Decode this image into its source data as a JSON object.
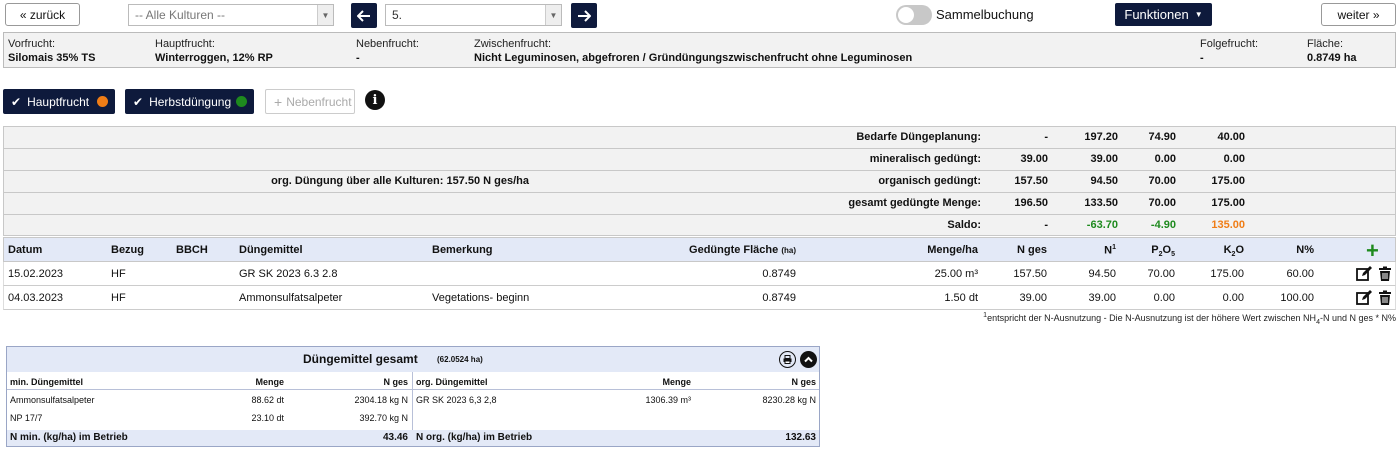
{
  "nav": {
    "back_label": "« zurück",
    "next_label": "weiter »",
    "culture_select": "-- Alle Kulturen --",
    "field_select": "5.",
    "prev_arrow": "🡐",
    "next_arrow": "🡒",
    "sammel_label": "Sammelbuchung",
    "sammel_on": false,
    "functions_label": "Funktionen"
  },
  "info": {
    "vorfrucht_label": "Vorfrucht:",
    "vorfrucht_value": "Silomais 35% TS",
    "hauptfrucht_label": "Hauptfrucht:",
    "hauptfrucht_value": "Winterroggen, 12% RP",
    "nebenfrucht_label": "Nebenfrucht:",
    "nebenfrucht_value": "-",
    "zwischenfrucht_label": "Zwischenfrucht:",
    "zwischenfrucht_value": "Nicht Leguminosen, abgefroren / Gründüngungszwischenfrucht ohne Leguminosen",
    "folgefrucht_label": "Folgefrucht:",
    "folgefrucht_value": "-",
    "flaeche_label": "Fläche:",
    "flaeche_value": "0.8749 ha"
  },
  "pills": {
    "hauptfrucht": "Hauptfrucht",
    "hauptfrucht_color": "#f07d16",
    "herbst": "Herbstdüngung",
    "herbst_color": "#1e8a1e",
    "neben": "Nebenfrucht"
  },
  "summary": {
    "org_note": "org. Düngung über alle Kulturen: 157.50 N ges/ha",
    "rows": [
      {
        "label": "Bedarfe Düngeplanung:",
        "v1": "-",
        "v2": "197.20",
        "v3": "74.90",
        "v4": "40.00"
      },
      {
        "label": "mineralisch gedüngt:",
        "v1": "39.00",
        "v2": "39.00",
        "v3": "0.00",
        "v4": "0.00"
      },
      {
        "label": "organisch gedüngt:",
        "v1": "157.50",
        "v2": "94.50",
        "v3": "70.00",
        "v4": "175.00"
      },
      {
        "label": "gesamt gedüngte Menge:",
        "v1": "196.50",
        "v2": "133.50",
        "v3": "70.00",
        "v4": "175.00"
      },
      {
        "label": "Saldo:",
        "v1": "-",
        "v2": "-63.70",
        "v3": "-4.90",
        "v4": "135.00"
      }
    ],
    "saldo_colors": {
      "negative": "#1e8a1e",
      "positive": "#f07d16"
    }
  },
  "table": {
    "headers": {
      "datum": "Datum",
      "bezug": "Bezug",
      "bbch": "BBCH",
      "duengemittel": "Düngemittel",
      "bemerkung": "Bemerkung",
      "flaeche": "Gedüngte Fläche",
      "flaeche_unit": "(ha)",
      "menge": "Menge/ha",
      "nges": "N ges",
      "n": "N",
      "n_sup": "1",
      "p": "P",
      "p_sub": "2",
      "p_o": "O",
      "p_sub2": "5",
      "k": "K",
      "k_sub": "2",
      "k_o": "O",
      "npct": "N%"
    },
    "rows": [
      {
        "datum": "15.02.2023",
        "bezug": "HF",
        "bbch": "",
        "duengemittel": "GR SK 2023 6.3 2.8",
        "bemerkung": "",
        "flaeche": "0.8749",
        "menge": "25.00 m³",
        "nges": "157.50",
        "n": "94.50",
        "p": "70.00",
        "k": "175.00",
        "npct": "60.00"
      },
      {
        "datum": "04.03.2023",
        "bezug": "HF",
        "bbch": "",
        "duengemittel": "Ammonsulfatsalpeter",
        "bemerkung": "Vegetations- beginn",
        "flaeche": "0.8749",
        "menge": "1.50 dt",
        "nges": "39.00",
        "n": "39.00",
        "p": "0.00",
        "k": "0.00",
        "npct": "100.00"
      }
    ],
    "footnote_sup": "1",
    "footnote_a": "entspricht der N-Ausnutzung - Die N-Ausnutzung ist der höhere Wert zwischen NH",
    "footnote_sub": "4",
    "footnote_b": "-N und N ges * N%"
  },
  "fert": {
    "title": "Düngemittel gesamt",
    "area": "(62.0524 ha)",
    "min_h1": "min. Düngemittel",
    "min_h2": "Menge",
    "min_h3": "N ges",
    "org_h1": "org. Düngemittel",
    "org_h2": "Menge",
    "org_h3": "N ges",
    "min_rows": [
      {
        "name": "Ammonsulfatsalpeter",
        "menge": "88.62 dt",
        "nges": "2304.18 kg N"
      },
      {
        "name": "NP 17/7",
        "menge": "23.10 dt",
        "nges": "392.70 kg N"
      }
    ],
    "org_rows": [
      {
        "name": "GR SK 2023 6,3 2,8",
        "menge": "1306.39 m³",
        "nges": "8230.28 kg N"
      }
    ],
    "min_total_label": "N min. (kg/ha) im Betrieb",
    "min_total": "43.46",
    "org_total_label": "N org. (kg/ha) im Betrieb",
    "org_total": "132.63"
  }
}
